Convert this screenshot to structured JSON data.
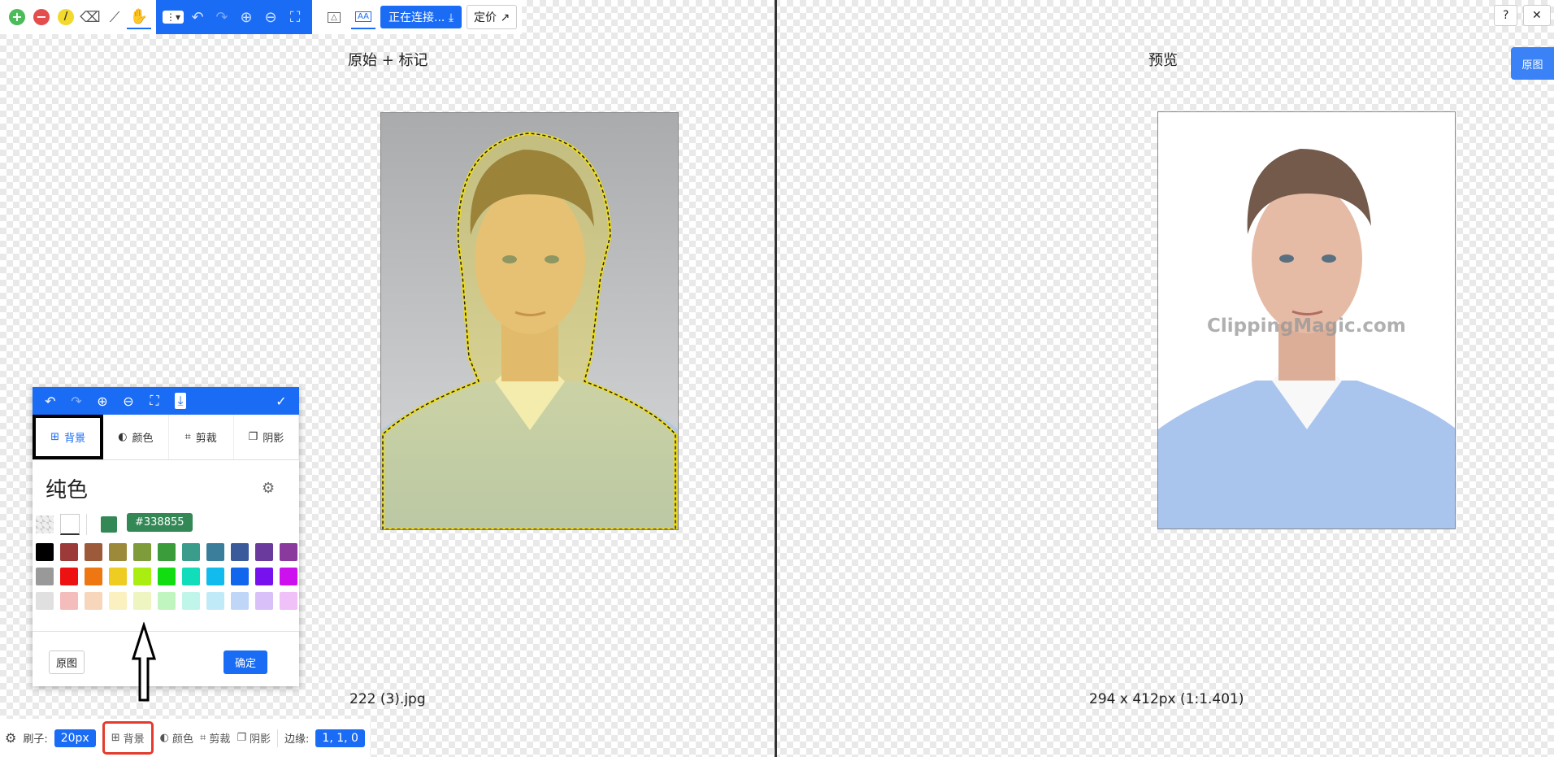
{
  "toolbar": {
    "connect_label": "正在连接...",
    "price_label": "定价",
    "help_label": "?",
    "close_label": "✕"
  },
  "original_button": "原图",
  "left_panel": {
    "title": "原始 + 标记",
    "filename": "222 (3).jpg"
  },
  "right_panel": {
    "title": "预览",
    "dimensions": "294 x 412px (1:1.401)",
    "watermark": "ClippingMagic.com"
  },
  "popup": {
    "tabs": [
      {
        "label": "背景",
        "icon": "grid-icon"
      },
      {
        "label": "颜色",
        "icon": "contrast-icon"
      },
      {
        "label": "剪裁",
        "icon": "crop-icon"
      },
      {
        "label": "阴影",
        "icon": "shadow-icon"
      }
    ],
    "heading": "纯色",
    "color_hex": "#338855",
    "swatches": [
      [
        "#000000",
        "#9c3a3a",
        "#9c5a3a",
        "#9c8a3a",
        "#7e9c3a",
        "#3a9c3a",
        "#3a9c8a",
        "#3a7e9c",
        "#3a5a9c",
        "#6a3a9c",
        "#8a3a9c"
      ],
      [
        "#999999",
        "#ee1111",
        "#ee7711",
        "#eecc22",
        "#aaee11",
        "#11dd11",
        "#11ddbb",
        "#11bbee",
        "#1166ee",
        "#7711ee",
        "#cc11ee"
      ],
      [
        "#e0e0e0",
        "#f5bcbc",
        "#f8d6bc",
        "#fbf0c0",
        "#eef5c0",
        "#c0f5c0",
        "#c0f5ea",
        "#c0eaf8",
        "#c0d6f8",
        "#dac0f8",
        "#f0c0f8"
      ]
    ],
    "cancel_label": "原图",
    "confirm_label": "确定"
  },
  "bottombar": {
    "brush_label": "刷子:",
    "brush_value": "20px",
    "background_label": "背景",
    "color_label": "颜色",
    "crop_label": "剪裁",
    "shadow_label": "阴影",
    "edge_label": "边缘:",
    "edge_value": "1, 1, 0"
  },
  "colors": {
    "accent": "#1a6cf5",
    "highlight": "#e33b2e",
    "selected_bg": "#338855"
  }
}
